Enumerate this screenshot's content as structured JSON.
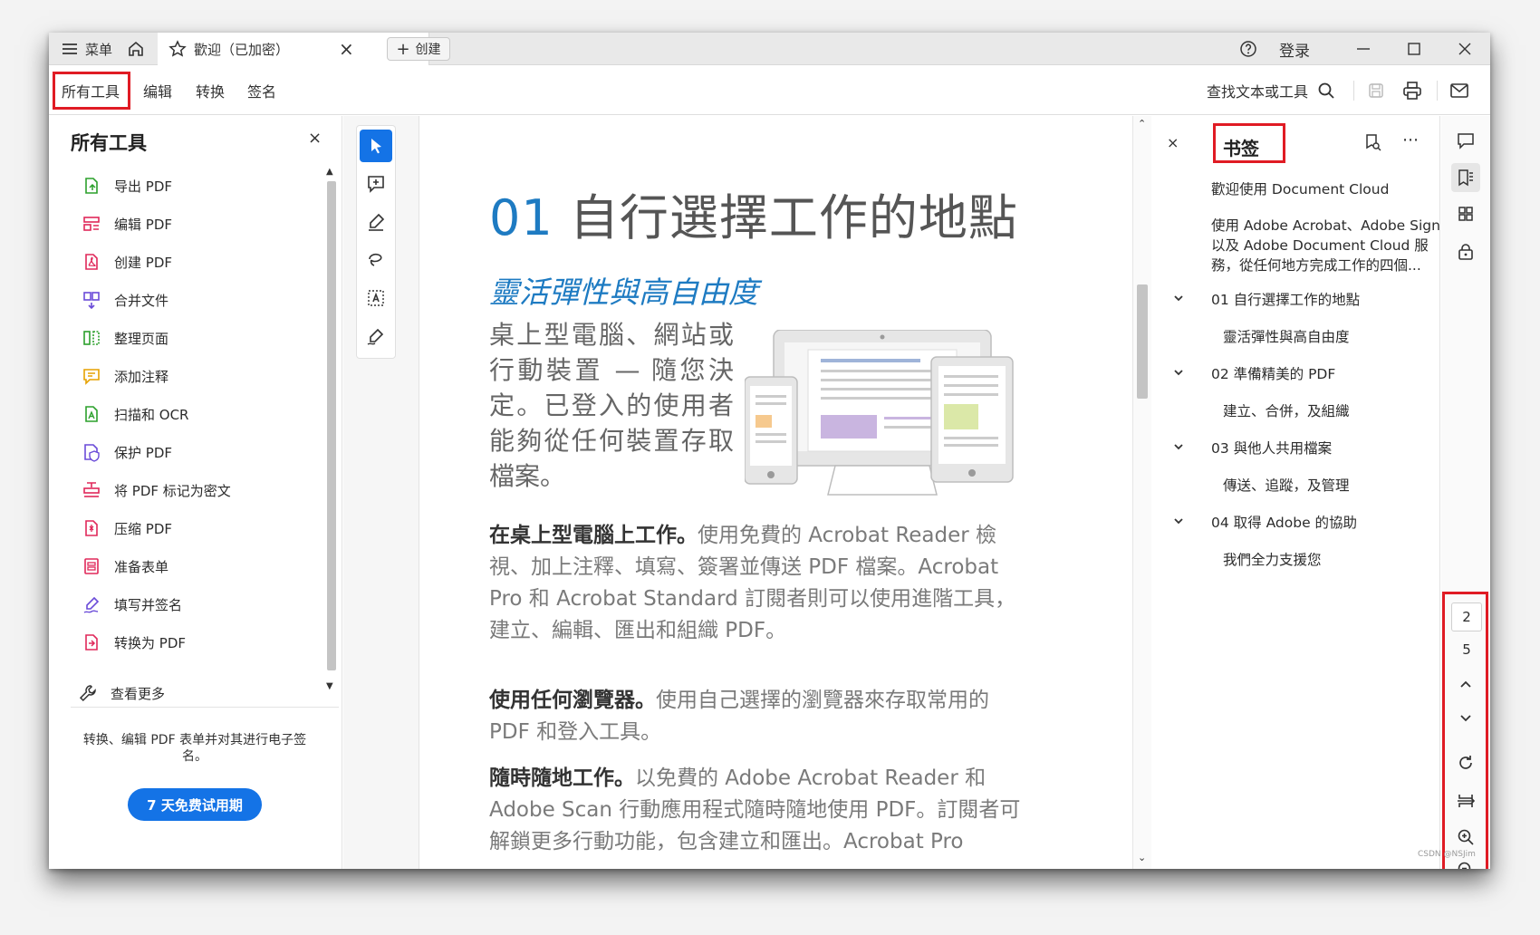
{
  "titlebar": {
    "menu_label": "菜单",
    "tab_title": "歡迎（已加密）",
    "tab_close": "×",
    "create_label": "创建",
    "login_label": "登录"
  },
  "toolbar": {
    "tabs": [
      "所有工具",
      "编辑",
      "转换",
      "签名"
    ],
    "search_label": "查找文本或工具"
  },
  "left_panel": {
    "title": "所有工具",
    "close": "×",
    "items": [
      {
        "label": "导出 PDF",
        "icon": "export-pdf-icon",
        "color": "#2ca02c"
      },
      {
        "label": "编辑 PDF",
        "icon": "edit-pdf-icon",
        "color": "#e0285a"
      },
      {
        "label": "创建 PDF",
        "icon": "create-pdf-icon",
        "color": "#e0285a"
      },
      {
        "label": "合并文件",
        "icon": "merge-files-icon",
        "color": "#6a4bd8"
      },
      {
        "label": "整理页面",
        "icon": "organize-pages-icon",
        "color": "#2ca02c"
      },
      {
        "label": "添加注释",
        "icon": "comment-icon",
        "color": "#e6a100"
      },
      {
        "label": "扫描和 OCR",
        "icon": "scan-ocr-icon",
        "color": "#2ca02c"
      },
      {
        "label": "保护 PDF",
        "icon": "protect-pdf-icon",
        "color": "#6a4bd8"
      },
      {
        "label": "将 PDF 标记为密文",
        "icon": "redact-icon",
        "color": "#e0285a"
      },
      {
        "label": "压缩 PDF",
        "icon": "compress-pdf-icon",
        "color": "#e0285a"
      },
      {
        "label": "准备表单",
        "icon": "prepare-form-icon",
        "color": "#e0285a"
      },
      {
        "label": "填写并签名",
        "icon": "fill-sign-icon",
        "color": "#6a4bd8"
      },
      {
        "label": "转换为 PDF",
        "icon": "convert-pdf-icon",
        "color": "#e0285a"
      }
    ],
    "more_label": "查看更多",
    "promo_text": "转换、编辑 PDF 表单并对其进行电子签名。",
    "trial_button": "7 天免费试用期"
  },
  "document": {
    "title_num": "01",
    "title_text": "自行選擇工作的地點",
    "subtitle": "靈活彈性與高自由度",
    "intro": "桌上型電腦、網站或行動裝置 — 隨您決定。已登入的使用者能夠從任何裝置存取檔案。",
    "p1_bold": "在桌上型電腦上工作。",
    "p1_text": "使用免費的 Acrobat Reader 檢視、加上注釋、填寫、簽署並傳送 PDF 檔案。Acrobat Pro 和 Acrobat Standard 訂閱者則可以使用進階工具，建立、編輯、匯出和組織 PDF。",
    "p2_bold": "使用任何瀏覽器。",
    "p2_text": "使用自己選擇的瀏覽器來存取常用的 PDF 和登入工具。",
    "p3_bold": "隨時隨地工作。",
    "p3_text": "以免費的 Adobe Acrobat Reader 和 Adobe Scan 行動應用程式隨時隨地使用 PDF。訂閱者可解鎖更多行動功能，包含建立和匯出。Acrobat Pro"
  },
  "bookmarks": {
    "title": "书签",
    "close": "×",
    "items": [
      {
        "label": "歡迎使用 Document Cloud",
        "level": 0,
        "chevron": false
      },
      {
        "label": "使用 Adobe Acrobat、Adobe Sign\n以及 Adobe Document Cloud 服\n務，從任何地方完成工作的四個...",
        "level": 0,
        "chevron": false
      },
      {
        "label": "01 自行選擇工作的地點",
        "level": 0,
        "chevron": true
      },
      {
        "label": "靈活彈性與高自由度",
        "level": 1,
        "chevron": false
      },
      {
        "label": "02 準備精美的 PDF",
        "level": 0,
        "chevron": true
      },
      {
        "label": "建立、合併，及組織",
        "level": 1,
        "chevron": false
      },
      {
        "label": "03 與他人共用檔案",
        "level": 0,
        "chevron": true
      },
      {
        "label": "傳送、追蹤，及管理",
        "level": 1,
        "chevron": false
      },
      {
        "label": "04 取得 Adobe 的協助",
        "level": 0,
        "chevron": true
      },
      {
        "label": "我們全力支援您",
        "level": 1,
        "chevron": false
      }
    ]
  },
  "page_nav": {
    "current_page": "2",
    "total_pages": "5"
  },
  "watermark": "CSDN @NSJim",
  "colors": {
    "accent_blue": "#1473e6",
    "doc_blue": "#1e7bc2",
    "highlight_red": "#e01b24"
  }
}
